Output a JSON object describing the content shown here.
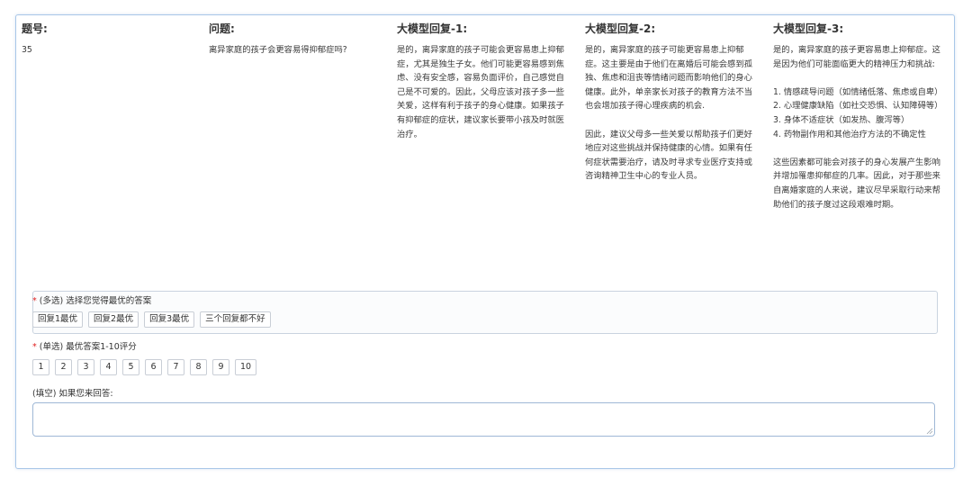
{
  "columns": [
    {
      "header": "题号:",
      "body": "35"
    },
    {
      "header": "问题:",
      "body": "离异家庭的孩子会更容易得抑郁症吗?"
    },
    {
      "header": "大模型回复-1:",
      "body": "是的，离异家庭的孩子可能会更容易患上抑郁症，尤其是独生子女。他们可能更容易感到焦虑、没有安全感，容易负面评价，自己感觉自己是不可爱的。因此，父母应该对孩子多一些关爱，这样有利于孩子的身心健康。如果孩子有抑郁症的症状，建议家长要带小孩及时就医治疗。"
    },
    {
      "header": "大模型回复-2:",
      "body": "是的，离异家庭的孩子可能更容易患上抑郁症。这主要是由于他们在离婚后可能会感到孤独、焦虑和沮丧等情绪问题而影响他们的身心健康。此外，单亲家长对孩子的教育方法不当也会增加孩子得心理疾病的机会.\n\n因此，建议父母多一些关爱以帮助孩子们更好地应对这些挑战并保持健康的心情。如果有任何症状需要治疗，请及时寻求专业医疗支持或咨询精神卫生中心的专业人员。"
    },
    {
      "header": "大模型回复-3:",
      "body": "是的，离异家庭的孩子更容易患上抑郁症。这是因为他们可能面临更大的精神压力和挑战:\n\n1. 情感疏导问题（如情绪低落、焦虑或自卑）\n2. 心理健康缺陷（如社交恐惧、认知障碍等）\n3. 身体不适症状（如发热、腹泻等）\n4. 药物副作用和其他治疗方法的不确定性\n\n这些因素都可能会对孩子的身心发展产生影响并增加罹患抑郁症的几率。因此，对于那些来自离婚家庭的人来说，建议尽早采取行动来帮助他们的孩子度过这段艰难时期。"
    }
  ],
  "multi": {
    "required_mark": "*",
    "label": " (多选) 选择您觉得最优的答案",
    "options": [
      "回复1最优",
      "回复2最优",
      "回复3最优",
      "三个回复都不好"
    ]
  },
  "single": {
    "required_mark": "*",
    "label": " (单选) 最优答案1-10评分",
    "options": [
      "1",
      "2",
      "3",
      "4",
      "5",
      "6",
      "7",
      "8",
      "9",
      "10"
    ]
  },
  "fill": {
    "label": "(填空) 如果您来回答:",
    "value": ""
  },
  "colors": {
    "panel_border": "#a9c7e8",
    "required": "#e02020",
    "text": "#333333"
  }
}
